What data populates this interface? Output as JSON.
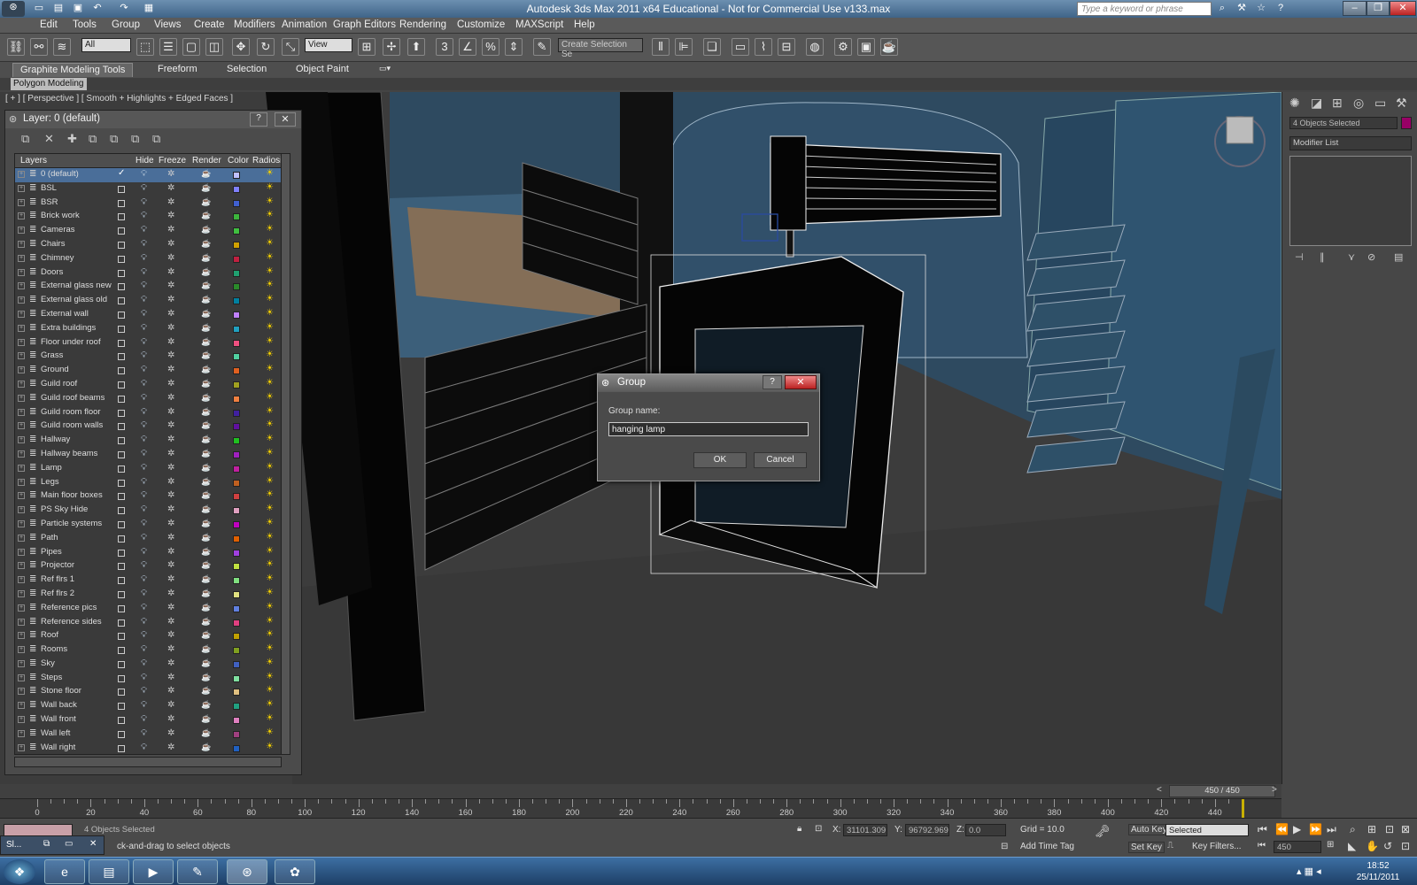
{
  "title": "Autodesk 3ds Max  2011 x64   Educational - Not for Commercial Use    v133.max",
  "search_placeholder": "Type a keyword or phrase",
  "menu": [
    "Edit",
    "Tools",
    "Group",
    "Views",
    "Create",
    "Modifiers",
    "Animation",
    "Graph Editors",
    "Rendering",
    "Customize",
    "MAXScript",
    "Help"
  ],
  "toolbar": {
    "selection_filter": "All",
    "ref_coord": "View",
    "named_selection": "Create Selection Se"
  },
  "ribbon": {
    "tabs": [
      "Graphite Modeling Tools",
      "Freeform",
      "Selection",
      "Object Paint"
    ],
    "panel": "Polygon Modeling"
  },
  "viewport": {
    "label": "[ + ] [ Perspective ] [ Smooth + Highlights + Edged Faces ]"
  },
  "layer_dialog": {
    "title": "Layer: 0 (default)",
    "columns": [
      "Layers",
      "Hide",
      "Freeze",
      "Render",
      "Color",
      "Radiosit"
    ],
    "rows": [
      {
        "name": "0 (default)",
        "color": "#c0c0ff",
        "active": true
      },
      {
        "name": "BSL",
        "color": "#8080ff"
      },
      {
        "name": "BSR",
        "color": "#4060d0"
      },
      {
        "name": "Brick work",
        "color": "#3cb43c"
      },
      {
        "name": "Cameras",
        "color": "#40c040"
      },
      {
        "name": "Chairs",
        "color": "#d0a000"
      },
      {
        "name": "Chimney",
        "color": "#c02040"
      },
      {
        "name": "Doors",
        "color": "#20a070"
      },
      {
        "name": "External glass new",
        "color": "#2a8a2a"
      },
      {
        "name": "External glass old",
        "color": "#0080a0"
      },
      {
        "name": "External wall",
        "color": "#c080ff"
      },
      {
        "name": "Extra buildings",
        "color": "#20a0c0"
      },
      {
        "name": "Floor under roof",
        "color": "#f05080"
      },
      {
        "name": "Grass",
        "color": "#50d0a0"
      },
      {
        "name": "Ground",
        "color": "#e06020"
      },
      {
        "name": "Guild roof",
        "color": "#a0a020"
      },
      {
        "name": "Guild roof beams",
        "color": "#f08040"
      },
      {
        "name": "Guild room floor",
        "color": "#4020a0"
      },
      {
        "name": "Guild room walls",
        "color": "#6010a0"
      },
      {
        "name": "Hallway",
        "color": "#20c020"
      },
      {
        "name": "Hallway beams",
        "color": "#a020c0"
      },
      {
        "name": "Lamp",
        "color": "#c020a0"
      },
      {
        "name": "Legs",
        "color": "#c06020"
      },
      {
        "name": "Main floor boxes",
        "color": "#d04040"
      },
      {
        "name": "PS Sky Hide",
        "color": "#e0a0c0"
      },
      {
        "name": "Particle systems",
        "color": "#c000c0"
      },
      {
        "name": "Path",
        "color": "#e06000"
      },
      {
        "name": "Pipes",
        "color": "#a040e0"
      },
      {
        "name": "Projector",
        "color": "#c0e040"
      },
      {
        "name": "Ref flrs 1",
        "color": "#80e080"
      },
      {
        "name": "Ref flrs 2",
        "color": "#e0e080"
      },
      {
        "name": "Reference pics",
        "color": "#6080e0"
      },
      {
        "name": "Reference sides",
        "color": "#e04080"
      },
      {
        "name": "Roof",
        "color": "#c0a000"
      },
      {
        "name": "Rooms",
        "color": "#80a020"
      },
      {
        "name": "Sky",
        "color": "#4060c0"
      },
      {
        "name": "Steps",
        "color": "#80e0a0"
      },
      {
        "name": "Stone floor",
        "color": "#e0c080"
      },
      {
        "name": "Wall back",
        "color": "#20a080"
      },
      {
        "name": "Wall front",
        "color": "#e080c0"
      },
      {
        "name": "Wall left",
        "color": "#a04080"
      },
      {
        "name": "Wall right",
        "color": "#2060c0"
      }
    ]
  },
  "group_dialog": {
    "title": "Group",
    "label": "Group name:",
    "value": "hanging lamp",
    "ok": "OK",
    "cancel": "Cancel"
  },
  "command_panel": {
    "selection_text": "4 Objects Selected",
    "selection_color": "#990066",
    "modifier_list": "Modifier List"
  },
  "timeline": {
    "frame": "450 / 450",
    "ticks": [
      "0",
      "20",
      "40",
      "60",
      "80",
      "100",
      "120",
      "140",
      "160",
      "180",
      "200",
      "220",
      "240",
      "260",
      "280",
      "300",
      "320",
      "340",
      "360",
      "380",
      "400",
      "420",
      "440"
    ]
  },
  "status": {
    "selected": "4 Objects Selected",
    "prompt": "ck-and-drag to select objects",
    "x_label": "X:",
    "x_value": "31101.309",
    "y_label": "Y:",
    "y_value": "96792.969",
    "z_label": "Z:",
    "z_value": "0.0",
    "grid": "Grid = 10.0",
    "add_time_tag": "Add Time Tag",
    "auto_key": "Auto Key",
    "set_key": "Set Key",
    "key_mode": "Selected",
    "key_filters": "Key Filters...",
    "frame_field": "450",
    "minwin_label": "Sl..."
  },
  "clock": {
    "time": "18:52",
    "date": "25/11/2011"
  }
}
